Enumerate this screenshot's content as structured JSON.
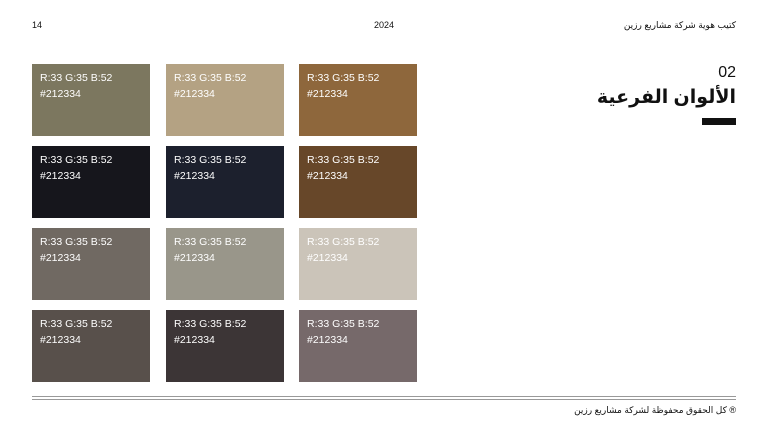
{
  "header": {
    "page_number": "14",
    "year": "2024",
    "doc_title": "كتيب هوية شركة مشاريع رزين"
  },
  "section": {
    "number": "02",
    "title": "الألوان الفرعية"
  },
  "swatches": [
    {
      "rgb": "R:33 G:35 B:52",
      "hex": "#212334",
      "color": "#7c775f",
      "text_color": "#ffffff"
    },
    {
      "rgb": "R:33 G:35 B:52",
      "hex": "#212334",
      "color": "#b4a283",
      "text_color": "#ffffff"
    },
    {
      "rgb": "R:33 G:35 B:52",
      "hex": "#212334",
      "color": "#8e673c",
      "text_color": "#ffffff"
    },
    {
      "rgb": "R:33 G:35 B:52",
      "hex": "#212334",
      "color": "#16161c",
      "text_color": "#ffffff"
    },
    {
      "rgb": "R:33 G:35 B:52",
      "hex": "#212334",
      "color": "#1c202d",
      "text_color": "#ffffff"
    },
    {
      "rgb": "R:33 G:35 B:52",
      "hex": "#212334",
      "color": "#674729",
      "text_color": "#ffffff"
    },
    {
      "rgb": "R:33 G:35 B:52",
      "hex": "#212334",
      "color": "#706962",
      "text_color": "#ffffff"
    },
    {
      "rgb": "R:33 G:35 B:52",
      "hex": "#212334",
      "color": "#99968a",
      "text_color": "#ffffff"
    },
    {
      "rgb": "R:33 G:35 B:52",
      "hex": "#212334",
      "color": "#cbc4b9",
      "text_color": "#ffffff"
    },
    {
      "rgb": "R:33 G:35 B:52",
      "hex": "#212334",
      "color": "#58504b",
      "text_color": "#ffffff"
    },
    {
      "rgb": "R:33 G:35 B:52",
      "hex": "#212334",
      "color": "#3c3536",
      "text_color": "#ffffff"
    },
    {
      "rgb": "R:33 G:35 B:52",
      "hex": "#212334",
      "color": "#76696a",
      "text_color": "#ffffff"
    }
  ],
  "footer": {
    "copyright": "® كل الحقوق محفوظة لشركة مشاريع رزين"
  }
}
